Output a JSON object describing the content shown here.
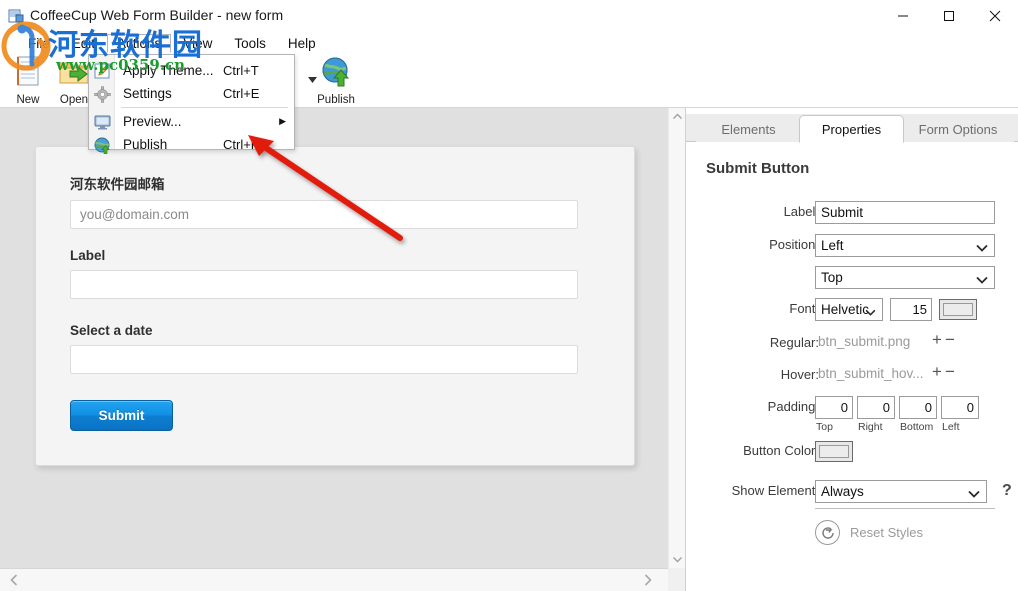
{
  "window": {
    "title": "CoffeeCup Web Form Builder - new form",
    "minimize": "—",
    "maximize": "☐",
    "close": "✕"
  },
  "menubar": {
    "items": [
      {
        "label": "File",
        "active": false
      },
      {
        "label": "Edit",
        "active": false
      },
      {
        "label": "Actions",
        "active": true
      },
      {
        "label": "View",
        "active": false
      },
      {
        "label": "Tools",
        "active": false
      },
      {
        "label": "Help",
        "active": false
      }
    ]
  },
  "toolbar": {
    "items": [
      {
        "label": "New",
        "icon": "new-document-icon"
      },
      {
        "label": "Open",
        "icon": "open-folder-icon"
      },
      {
        "label": "Publish",
        "icon": "globe-publish-icon"
      }
    ]
  },
  "dropdown": {
    "items": [
      {
        "label": "Apply Theme...",
        "accel": "Ctrl+T",
        "icon": "pencil-theme-icon",
        "submenu": ""
      },
      {
        "label": "Settings",
        "accel": "Ctrl+E",
        "icon": "gear-icon",
        "submenu": ""
      },
      {
        "label": "Preview...",
        "accel": "",
        "icon": "monitor-preview-icon",
        "submenu": "▶"
      },
      {
        "label": "Publish",
        "accel": "Ctrl+P",
        "icon": "globe-publish-icon",
        "submenu": ""
      }
    ]
  },
  "form_preview": {
    "fields": [
      {
        "label": "河东软件园邮箱",
        "value": "",
        "placeholder": "you@domain.com"
      },
      {
        "label": "Label",
        "value": "",
        "placeholder": ""
      },
      {
        "label": "Select a date",
        "value": "",
        "placeholder": ""
      }
    ],
    "submit_label": "Submit",
    "submit_color": "#1190e3"
  },
  "right_panel": {
    "tabs": [
      {
        "label": "Elements",
        "active": false
      },
      {
        "label": "Properties",
        "active": true
      },
      {
        "label": "Form Options",
        "active": false
      }
    ],
    "title": "Submit Button",
    "properties": {
      "label_caption": "Label:",
      "label_value": "Submit",
      "position_caption": "Position:",
      "position_value": "Left",
      "position_value2": "Top",
      "font_caption": "Font:",
      "font_value": "Helvetic",
      "font_size": "15",
      "regular_caption": "Regular:",
      "regular_value": "btn_submit.png",
      "hover_caption": "Hover:",
      "hover_value": "btn_submit_hov...",
      "plus_icon": "+",
      "minus_icon": "−",
      "padding_caption": "Padding:",
      "padding": [
        {
          "value": "0",
          "caption": "Top"
        },
        {
          "value": "0",
          "caption": "Right"
        },
        {
          "value": "0",
          "caption": "Bottom"
        },
        {
          "value": "0",
          "caption": "Left"
        }
      ],
      "button_color_caption": "Button Color:",
      "show_element_caption": "Show Element:",
      "show_element_value": "Always",
      "help_icon": "?",
      "reset_label": "Reset Styles",
      "reset_icon": "⟳"
    }
  },
  "scrollbars": {
    "up_arrow": "⌃",
    "down_arrow": "⌄",
    "left_arrow": "❮",
    "right_arrow": "❯"
  },
  "watermark": {
    "chinese": "河东软件园",
    "url": "www.pc0359.cn"
  }
}
